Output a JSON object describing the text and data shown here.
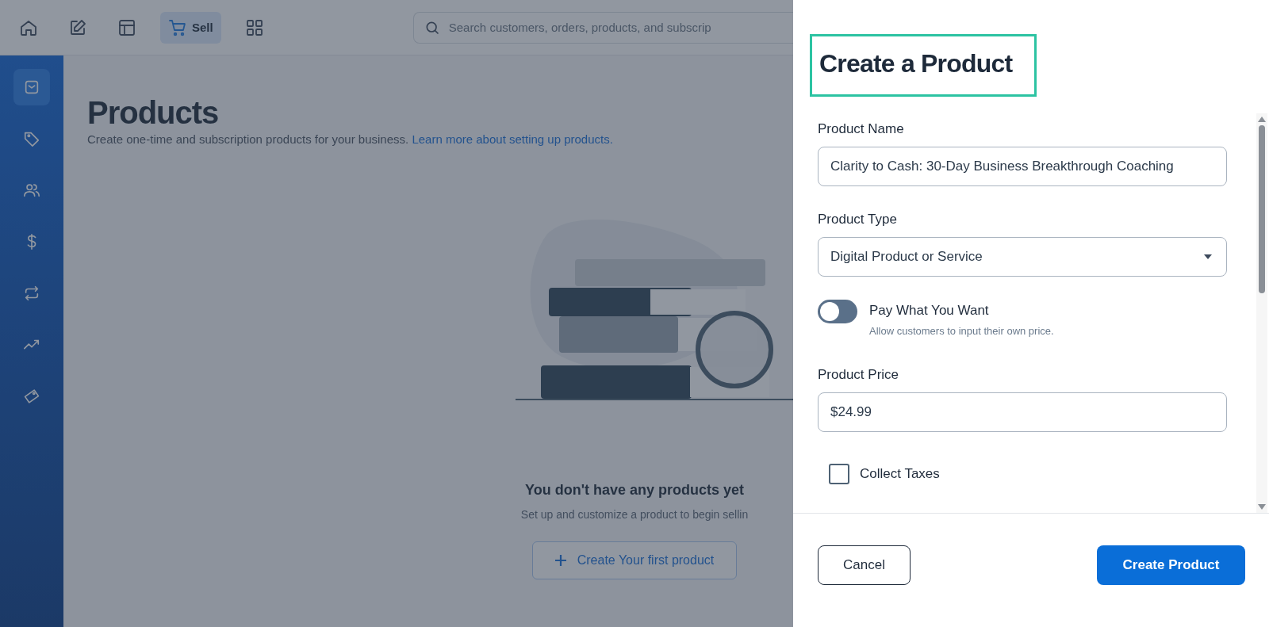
{
  "top_bar": {
    "nav": [
      {
        "selected": false
      },
      {
        "selected": false
      },
      {
        "selected": false
      },
      {
        "selected": true,
        "label": "Sell"
      },
      {
        "selected": false
      }
    ],
    "search": {
      "placeholder": "Search customers, orders, products, and subscrip"
    }
  },
  "sidebar": {
    "items": [
      {
        "selected": true
      },
      {
        "selected": false
      },
      {
        "selected": false
      },
      {
        "selected": false
      },
      {
        "selected": false
      },
      {
        "selected": false
      },
      {
        "selected": false
      }
    ]
  },
  "page": {
    "title": "Products",
    "subtitle": "Create one-time and subscription products for your business.",
    "link": "Learn more about setting up products.",
    "empty_state": {
      "heading": "You don't have any products yet",
      "text": "Set up and customize a product to begin sellin",
      "button": "Create Your first product"
    }
  },
  "drawer": {
    "title": "Create a Product",
    "fields": [
      {
        "kind": "text",
        "label": "Product Name",
        "value": "Clarity to Cash: 30-Day Business Breakthrough Coaching"
      },
      {
        "kind": "select",
        "label": "Product Type",
        "value": "Digital Product or Service"
      },
      {
        "kind": "toggle",
        "label": "Pay What You Want",
        "hint": "Allow customers to input their own price.",
        "on": false
      },
      {
        "kind": "text",
        "label": "Product Price",
        "value": "$24.99"
      },
      {
        "kind": "checkbox",
        "label": "Collect Taxes",
        "checked": false
      }
    ],
    "cancel": "Cancel",
    "submit": "Create Product"
  }
}
